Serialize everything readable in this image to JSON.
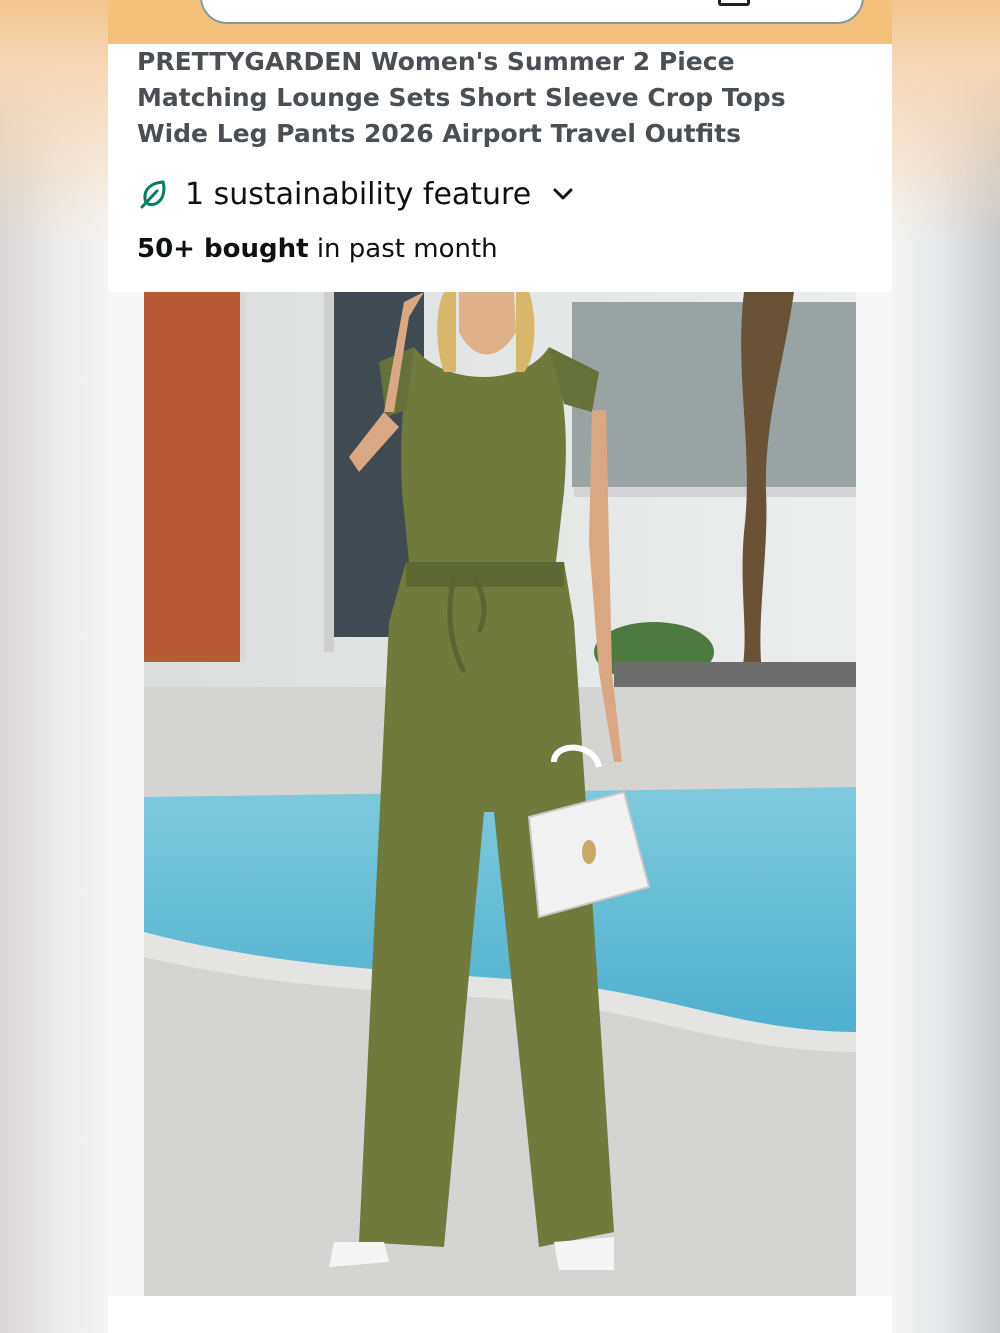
{
  "header": {
    "search_placeholder": "",
    "camera_icon": "camera-icon",
    "mic_icon": "microphone-icon"
  },
  "product": {
    "title": "PRETTYGARDEN Women's Summer 2 Piece Matching Lounge Sets Short Sleeve Crop Tops Wide Leg Pants 2026 Airport Travel Outfits",
    "sustainability_label": "1 sustainability feature",
    "sustainability_icon": "leaf-icon",
    "sustainability_color": "#067d62",
    "bought_bold": "50+ bought",
    "bought_rest": " in past month",
    "image_alt": "Woman wearing olive green ribbed crop top and wide leg pants holding white handbag by pool"
  },
  "colors": {
    "header_bg": "#f5c07c",
    "text_primary": "#0f1111",
    "text_title": "#4a4f55",
    "outfit_green": "#6f7a3c"
  }
}
